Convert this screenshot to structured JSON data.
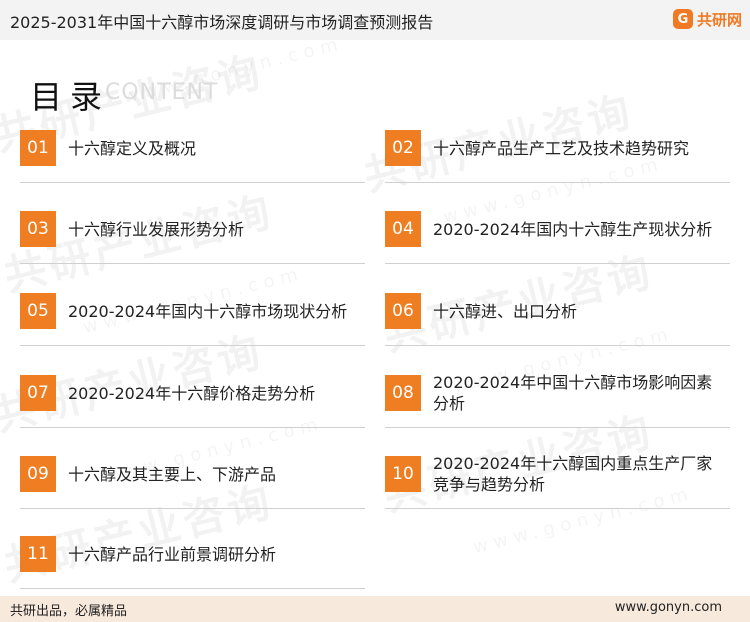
{
  "header": {
    "title": "2025-2031年中国十六醇市场深度调研与市场调查预测报告",
    "brand_mark": "G",
    "brand_name": "共研网"
  },
  "heading": {
    "main": "目录",
    "sub": "CONTENT"
  },
  "items": [
    {
      "num": "01",
      "label": "十六醇定义及概况"
    },
    {
      "num": "02",
      "label": "十六醇产品生产工艺及技术趋势研究"
    },
    {
      "num": "03",
      "label": "十六醇行业发展形势分析"
    },
    {
      "num": "04",
      "label": "2020-2024年国内十六醇生产现状分析"
    },
    {
      "num": "05",
      "label": "2020-2024年国内十六醇市场现状分析"
    },
    {
      "num": "06",
      "label": "十六醇进、出口分析"
    },
    {
      "num": "07",
      "label": "2020-2024年十六醇价格走势分析"
    },
    {
      "num": "08",
      "label": "2020-2024年中国十六醇市场影响因素分析"
    },
    {
      "num": "09",
      "label": "十六醇及其主要上、下游产品"
    },
    {
      "num": "10",
      "label": "2020-2024年十六醇国内重点生产厂家竞争与趋势分析"
    },
    {
      "num": "11",
      "label": "十六醇产品行业前景调研分析"
    }
  ],
  "watermark": {
    "text": "共研产业咨询",
    "url": "www.gonyn.com"
  },
  "footer": {
    "slogan": "共研出品，必属精品",
    "site": "www.gonyn.com"
  },
  "colors": {
    "accent": "#ef7d21",
    "footer_bg": "#f7e9dc",
    "header_bg": "#f3f3f3"
  }
}
